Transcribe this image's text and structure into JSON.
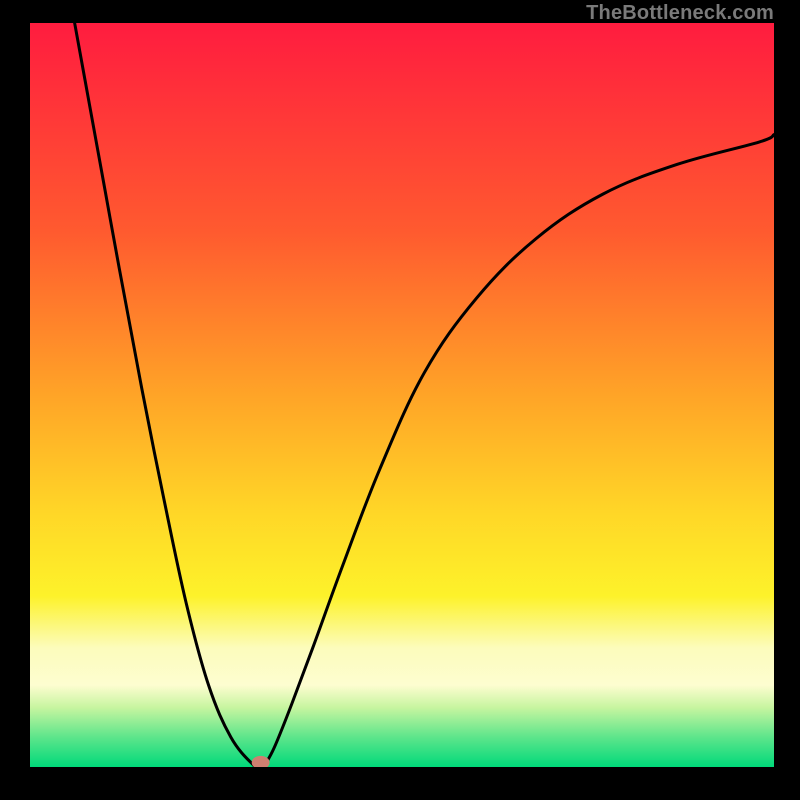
{
  "watermark": "TheBottleneck.com",
  "chart_data": {
    "type": "line",
    "title": "",
    "xlabel": "",
    "ylabel": "",
    "xlim": [
      0,
      100
    ],
    "ylim": [
      0,
      100
    ],
    "grid": false,
    "series": [
      {
        "name": "curve",
        "x": [
          6,
          8,
          10,
          12,
          15,
          18,
          21,
          24,
          27,
          30,
          31,
          31.5,
          32,
          33,
          35,
          38,
          42,
          47,
          53,
          60,
          68,
          77,
          87,
          98,
          100
        ],
        "values": [
          100,
          89,
          78,
          67,
          51,
          36,
          22,
          11,
          4,
          0.3,
          0,
          0.2,
          1,
          3,
          8,
          16,
          27,
          40,
          53,
          63,
          71,
          77,
          81,
          84,
          85
        ]
      }
    ],
    "marker": {
      "x": 31,
      "y": 0.6,
      "rx": 1.2,
      "ry": 0.9,
      "color": "#cf7f70"
    },
    "gradient_stops": [
      {
        "pos": 0,
        "color": "#ff1c3f"
      },
      {
        "pos": 28,
        "color": "#ff5a2f"
      },
      {
        "pos": 50,
        "color": "#ffa427"
      },
      {
        "pos": 66,
        "color": "#ffd727"
      },
      {
        "pos": 77,
        "color": "#fdf22a"
      },
      {
        "pos": 84,
        "color": "#fcfcbc"
      },
      {
        "pos": 89,
        "color": "#fdfdd0"
      },
      {
        "pos": 92,
        "color": "#c7f5a0"
      },
      {
        "pos": 96,
        "color": "#5de58b"
      },
      {
        "pos": 100,
        "color": "#00d97a"
      }
    ]
  }
}
